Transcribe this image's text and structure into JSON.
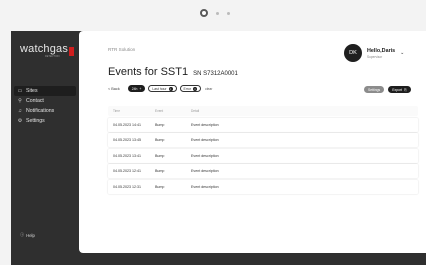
{
  "device": {
    "dots": [
      "active",
      "inactive",
      "inactive"
    ]
  },
  "brand": {
    "name": "watchgas",
    "sub": "DETECTION"
  },
  "sidebar": {
    "items": [
      {
        "label": "Sites",
        "icon": "building-icon",
        "active": true
      },
      {
        "label": "Contact",
        "icon": "person-icon",
        "active": false
      },
      {
        "label": "Notifications",
        "icon": "bell-icon",
        "active": false
      },
      {
        "label": "Settings",
        "icon": "gear-icon",
        "active": false
      }
    ],
    "help": "Help"
  },
  "header": {
    "org": "RTR Solution",
    "user": {
      "initials": "DK",
      "name": "Hello,Daris",
      "role": "Supervisor"
    }
  },
  "page": {
    "title": "Events for SST1",
    "sn": "SN S7312A0001"
  },
  "filters": {
    "back": "< Back",
    "chips": [
      {
        "label": "24h",
        "style": "dark"
      },
      {
        "label": "Last hour",
        "style": "light"
      },
      {
        "label": "Error",
        "style": "light"
      }
    ],
    "clear": "clear"
  },
  "actions": {
    "settings": "Settings",
    "export": "Export"
  },
  "table": {
    "headers": [
      "Time",
      "Event",
      "Detail"
    ],
    "rows": [
      [
        "04.05.2023 14:41",
        "Bump",
        "Event description"
      ],
      [
        "04.05.2023 13:45",
        "Bump",
        "Event description"
      ],
      [
        "04.05.2023 13:41",
        "Bump",
        "Event description"
      ],
      [
        "04.05.2023 12:41",
        "Bump",
        "Event description"
      ],
      [
        "04.05.2023 12:31",
        "Bump",
        "Event description"
      ]
    ]
  }
}
